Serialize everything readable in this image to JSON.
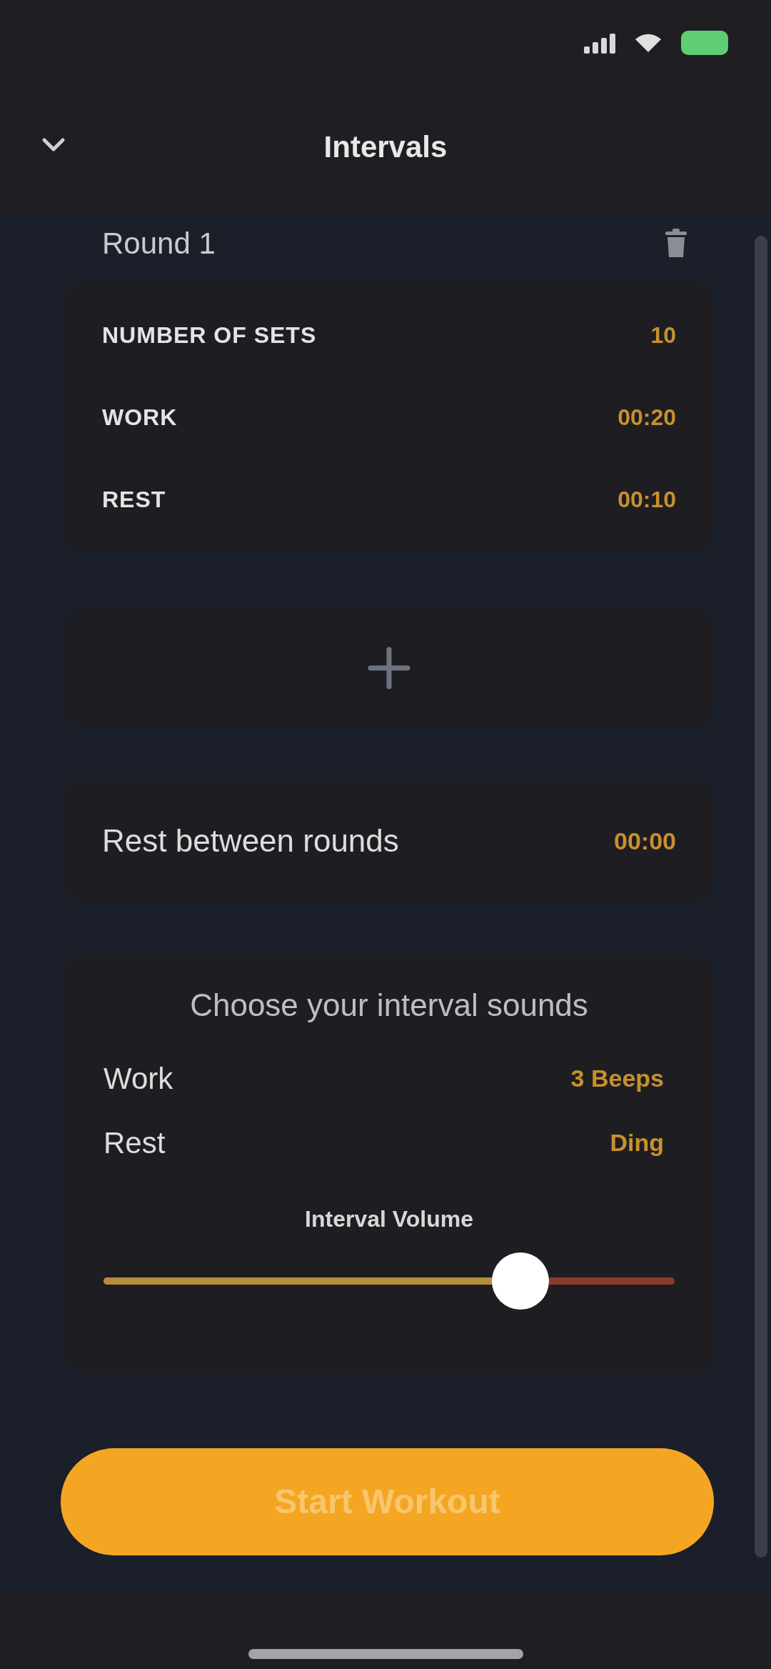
{
  "header": {
    "title": "Intervals"
  },
  "rounds": [
    {
      "title": "Round 1",
      "settings": [
        {
          "label": "NUMBER OF SETS",
          "value": "10"
        },
        {
          "label": "WORK",
          "value": "00:20"
        },
        {
          "label": "REST",
          "value": "00:10"
        }
      ]
    }
  ],
  "rest_between_rounds": {
    "label": "Rest between rounds",
    "value": "00:00"
  },
  "sounds": {
    "title": "Choose your interval sounds",
    "items": [
      {
        "label": "Work",
        "value": "3 Beeps"
      },
      {
        "label": "Rest",
        "value": "Ding"
      }
    ],
    "volume": {
      "label": "Interval Volume",
      "level": 0.73
    }
  },
  "start_button": {
    "label": "Start Workout"
  }
}
